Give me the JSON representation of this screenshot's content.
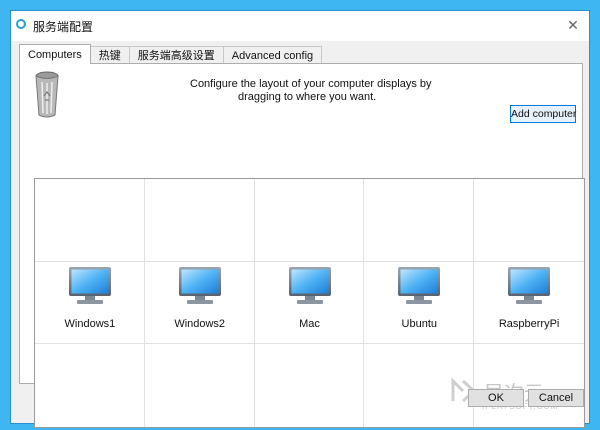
{
  "window": {
    "title": "服务端配置",
    "close_icon": "close-icon"
  },
  "tabs": [
    {
      "label": "Computers",
      "active": true
    },
    {
      "label": "热键",
      "active": false
    },
    {
      "label": "服务端高级设置",
      "active": false
    },
    {
      "label": "Advanced config",
      "active": false
    }
  ],
  "instructions": {
    "line1": "Configure the layout of your computer displays by",
    "line2": "dragging to where you want."
  },
  "toolbar": {
    "add_computer_label": "Add computer"
  },
  "layout_grid": {
    "rows": 3,
    "columns": 5,
    "computers": [
      {
        "name": "Windows1",
        "row": 2,
        "column": 1
      },
      {
        "name": "Windows2",
        "row": 2,
        "column": 2
      },
      {
        "name": "Mac",
        "row": 2,
        "column": 3
      },
      {
        "name": "Ubuntu",
        "row": 2,
        "column": 4
      },
      {
        "name": "RaspberryPi",
        "row": 2,
        "column": 5
      }
    ]
  },
  "watermark": {
    "title": "异次元",
    "subtitle": "IPLAYSOFT.COM"
  },
  "dialog_buttons": {
    "ok_label": "OK",
    "cancel_label": "Cancel"
  },
  "colors": {
    "background": "#3db6f2",
    "accent": "#0078d7"
  }
}
